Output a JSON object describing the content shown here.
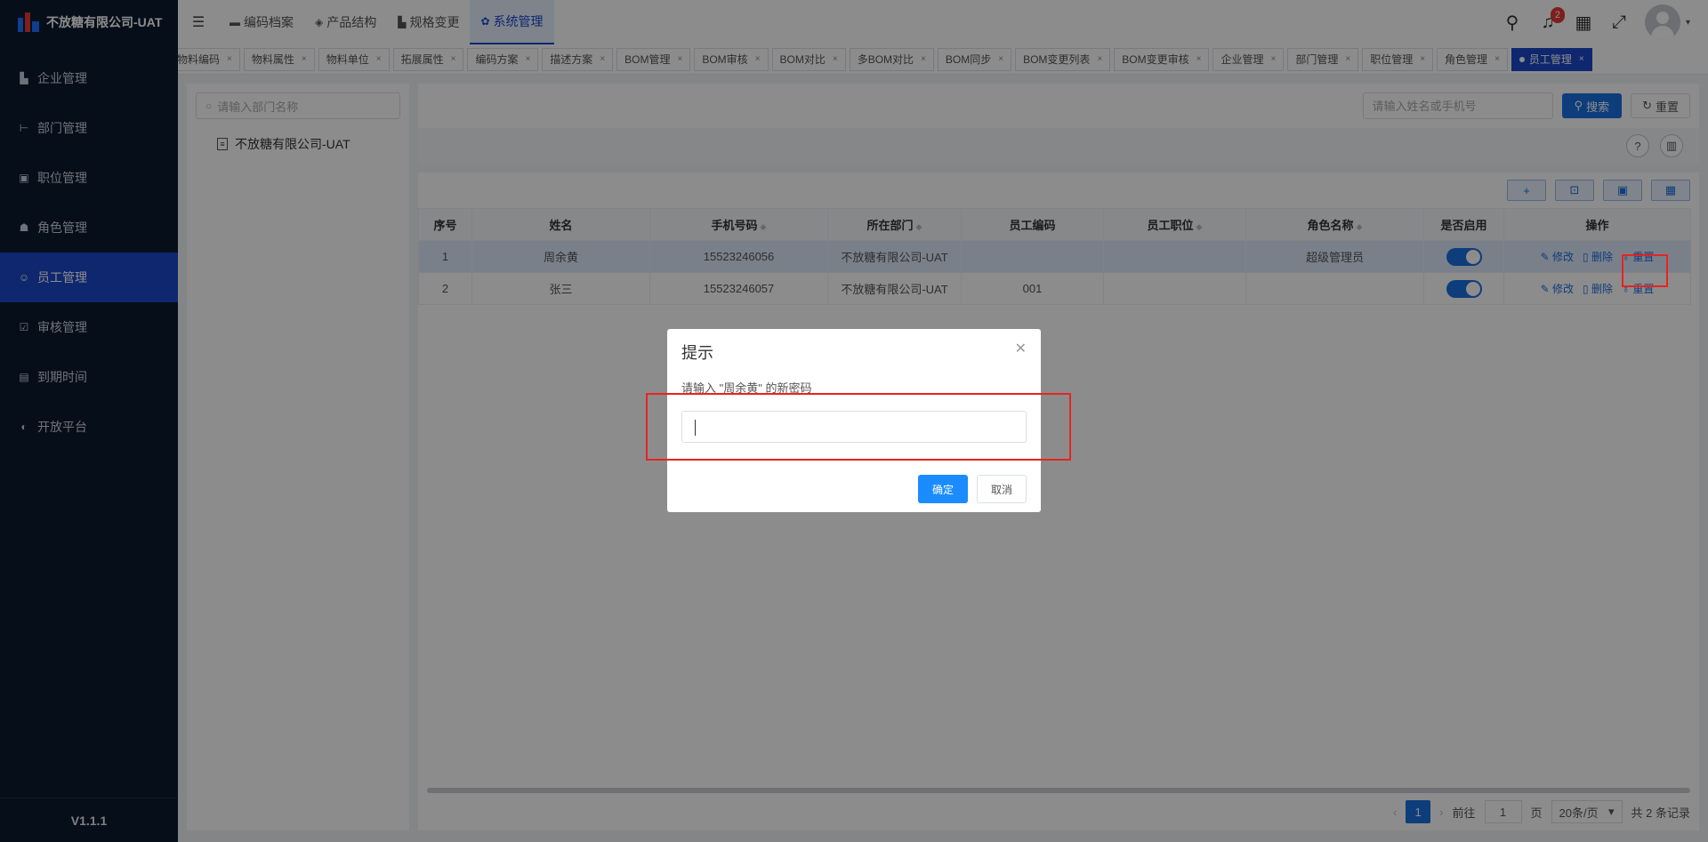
{
  "app": {
    "title": "不放糖有限公司-UAT",
    "version": "V1.1.1"
  },
  "sidebar": {
    "items": [
      {
        "label": "企业管理",
        "icon": "building-icon"
      },
      {
        "label": "部门管理",
        "icon": "org-tree-icon"
      },
      {
        "label": "职位管理",
        "icon": "badge-icon"
      },
      {
        "label": "角色管理",
        "icon": "role-icon"
      },
      {
        "label": "员工管理",
        "icon": "user-icon"
      },
      {
        "label": "审核管理",
        "icon": "check-icon"
      },
      {
        "label": "到期时间",
        "icon": "calendar-icon"
      },
      {
        "label": "开放平台",
        "icon": "platform-icon"
      }
    ],
    "active_index": 4
  },
  "topnav": {
    "items": [
      {
        "label": "编码档案"
      },
      {
        "label": "产品结构"
      },
      {
        "label": "规格变更"
      },
      {
        "label": "系统管理"
      }
    ],
    "notification_count": "2"
  },
  "tabs": [
    "物料编码",
    "物料属性",
    "物料单位",
    "拓展属性",
    "编码方案",
    "描述方案",
    "BOM管理",
    "BOM审核",
    "BOM对比",
    "多BOM对比",
    "BOM同步",
    "BOM变更列表",
    "BOM变更审核",
    "企业管理",
    "部门管理",
    "职位管理",
    "角色管理",
    "员工管理"
  ],
  "dept": {
    "search_placeholder": "请输入部门名称",
    "root": "不放糖有限公司-UAT"
  },
  "filter": {
    "placeholder": "请输入姓名或手机号",
    "search_label": "搜索",
    "reset_label": "重置"
  },
  "table": {
    "headers": [
      "序号",
      "姓名",
      "手机号码",
      "所在部门",
      "员工编码",
      "员工职位",
      "角色名称",
      "是否启用",
      "操作"
    ],
    "rows": [
      {
        "index": "1",
        "name": "周余黄",
        "phone": "15523246056",
        "dept": "不放糖有限公司-UAT",
        "code": "",
        "position": "",
        "role": "超级管理员"
      },
      {
        "index": "2",
        "name": "张三",
        "phone": "15523246057",
        "dept": "不放糖有限公司-UAT",
        "code": "001",
        "position": "",
        "role": ""
      }
    ],
    "ops": {
      "edit": "修改",
      "delete": "删除",
      "reset": "重置"
    }
  },
  "pager": {
    "current": "1",
    "goto_prefix": "前往",
    "goto_value": "1",
    "goto_suffix": "页",
    "page_size": "20条/页",
    "total": "共 2 条记录"
  },
  "dialog": {
    "title": "提示",
    "message": "请输入 \"周余黄\" 的新密码",
    "confirm": "确定",
    "cancel": "取消"
  }
}
